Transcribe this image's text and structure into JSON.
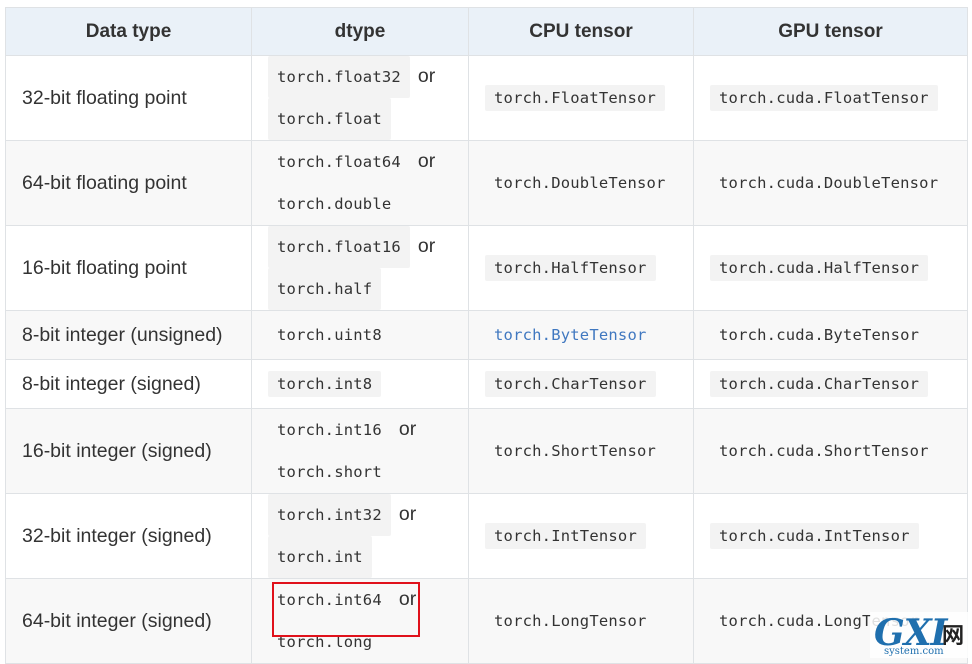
{
  "table": {
    "headers": [
      "Data type",
      "dtype",
      "CPU tensor",
      "GPU tensor"
    ],
    "or_label": "or",
    "rows": [
      {
        "data_type": "32-bit floating point",
        "dtype": [
          "torch.float32",
          "torch.float"
        ],
        "cpu": "torch.FloatTensor",
        "gpu": "torch.cuda.FloatTensor"
      },
      {
        "data_type": "64-bit floating point",
        "dtype": [
          "torch.float64",
          "torch.double"
        ],
        "cpu": "torch.DoubleTensor",
        "gpu": "torch.cuda.DoubleTensor"
      },
      {
        "data_type": "16-bit floating point",
        "dtype": [
          "torch.float16",
          "torch.half"
        ],
        "cpu": "torch.HalfTensor",
        "gpu": "torch.cuda.HalfTensor"
      },
      {
        "data_type": "8-bit integer (unsigned)",
        "dtype": [
          "torch.uint8"
        ],
        "cpu": "torch.ByteTensor",
        "gpu": "torch.cuda.ByteTensor"
      },
      {
        "data_type": "8-bit integer (signed)",
        "dtype": [
          "torch.int8"
        ],
        "cpu": "torch.CharTensor",
        "gpu": "torch.cuda.CharTensor"
      },
      {
        "data_type": "16-bit integer (signed)",
        "dtype": [
          "torch.int16",
          "torch.short"
        ],
        "cpu": "torch.ShortTensor",
        "gpu": "torch.cuda.ShortTensor"
      },
      {
        "data_type": "32-bit integer (signed)",
        "dtype": [
          "torch.int32",
          "torch.int"
        ],
        "cpu": "torch.IntTensor",
        "gpu": "torch.cuda.IntTensor"
      },
      {
        "data_type": "64-bit integer (signed)",
        "dtype": [
          "torch.int64",
          "torch.long"
        ],
        "cpu": "torch.LongTensor",
        "gpu": "torch.cuda.LongTensor"
      }
    ]
  },
  "watermark": {
    "brand": "GXI",
    "suffix": "网",
    "site": "system.com"
  },
  "colors": {
    "header_bg": "#eaf1f8",
    "link": "#4078c0",
    "highlight": "#e0111b",
    "watermark": "#1f6fae"
  }
}
